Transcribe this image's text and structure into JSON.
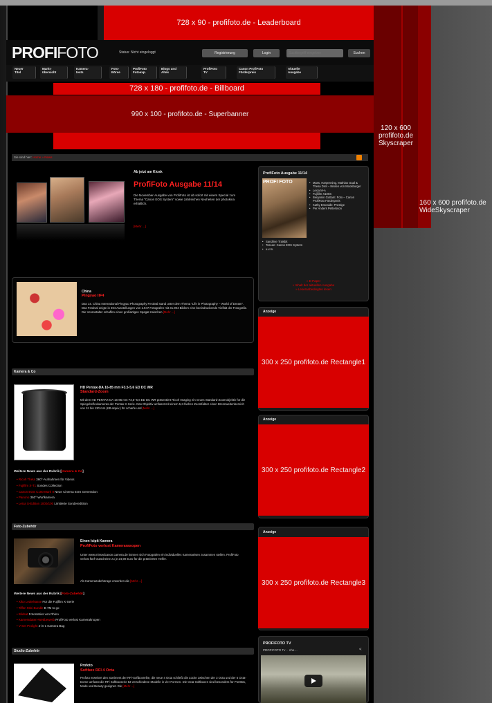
{
  "ads": {
    "leaderboard": "728 x 90 - profifoto.de - Leaderboard",
    "billboard": "728 x 180 - profifoto.de - Billboard",
    "superbanner": "990 x 100 - profifoto.de - Superbanner",
    "skyscraper": "120 x 600 profifoto.de Skyscraper",
    "wide_skyscraper": "160 x 600 profifoto.de WideSkyscraper",
    "rect1": "300 x 250 profifoto.de Rectangle1",
    "rect2": "300 x 250 profifoto.de Rectangle2",
    "rect3": "300 x 250 profifoto.de Rectangle3",
    "ad_label": "Anzeige"
  },
  "header": {
    "logo_bold": "PROFI",
    "logo_thin": "FOTO",
    "status": "Status: Nicht eingeloggt",
    "register": "Registrierung",
    "login": "Login",
    "search_placeholder": "Suchbegriff eingeben",
    "search_btn": "Suchen"
  },
  "nav": [
    {
      "label": "Neuer Titel"
    },
    {
      "label": "Markt-übersicht"
    },
    {
      "label": "Kamera-tests"
    },
    {
      "label": "Foto-Börse"
    },
    {
      "label": "ProfiFoto Fotoexp."
    },
    {
      "label": "Blogs und Altes"
    },
    {
      "label": "ProfiFoto TV"
    },
    {
      "label": "Canon ProfiFoto Förderpreis"
    },
    {
      "label": "Aktuelle Ausgabe"
    }
  ],
  "breadcrumb": {
    "prefix": "Sie sind hier:",
    "path": "Home » News"
  },
  "issue": {
    "kicker": "Ab jetzt am Kiosk",
    "title": "ProfiFoto Ausgabe 11/14",
    "text": "Die November-Ausgabe von ProfiFoto ist ab sofort mit einem Special zum Thema \"Canon EOS System\" sowie zahlreichen Neuheiten der photokina erhältlich.",
    "more": "[Mehr ...]"
  },
  "china": {
    "kicker": "China",
    "title": "Pingyao IIF4",
    "text": "Das 14. China International Pingyao Photography Festival stand unter dem Thema \"Life in Photography – World of Dream\". Das Festival zeigte in 494 Ausstellungen von 1.947 Fotografen mit 31.904 Bildern eine beeindruckende Vielfalt der Fotografie. Die Veranstalter schaffen einen großartigen Spagat zwischen",
    "more": "[Mehr ...]"
  },
  "sections": {
    "kamera": "Kamera & Co",
    "foto": "Foto-Zubehör",
    "studio": "Studio-Zubehör"
  },
  "lens": {
    "kicker": "HD Pentax-DA 16-85 mm F3.5-5.6 ED DC WR",
    "title": "Standard-Zoom",
    "text": "Mit dem HD PENTAX-DA 16-85 mm F3,5–5,6 ED DC WR präsentiert Ricoh Imaging ein neues Standard-Zoomobjektiv für die Spiegelreflexkameras der Pentax K-Serie. Das Objektiv umfasst mit einem 5,3-fachen Zoomfaktor einen Brennweitenbereich von 24 bis 130 mm (KB-äquiv.) für scharfe und",
    "more": "[Mehr ...]"
  },
  "more_kamera": {
    "head": "Weitere News aus der Rubrik",
    "rubric": "Kamera & Co",
    "items": [
      {
        "link": "Ricoh Theta",
        "text": " 360°-Aufnahmen für Videos"
      },
      {
        "link": "Fujifilm X-T1",
        "text": " Sondes Collection"
      },
      {
        "link": "Canon EOS C100 Mark II",
        "text": " Neue Cinema EOS Generation"
      },
      {
        "link": "Panono",
        "text": " 360°-Wurfkamera"
      },
      {
        "link": "Leica S-Edition 1000/100",
        "text": " Limitierte Sondereditiion"
      }
    ]
  },
  "cam": {
    "kicker": "Einen Icipit Kamera",
    "title": "ProfiFoto verlost Kamerarasopen",
    "text": "Unter www.missedcanon.camera.de können sich Fotografen ein individuelles Kameraeisen zusammen stellen. ProfiFoto verlost fünf Gutscheine zu je 24,90 Euro für die prämierten Helfer.",
    "text2": "Als Kamerazubehörage erwerben die",
    "more": "[Mehr ...]"
  },
  "more_foto": {
    "head": "Weitere News aus der Rubrik",
    "rubric": "Foto-Zubehör",
    "items": [
      {
        "link": "Xiko Lederkasse",
        "text": " Für die Fujifilm X-Serie"
      },
      {
        "link": "Tiffen Mini Bundle",
        "text": " B 7M to go"
      },
      {
        "link": "Bildsat",
        "text": " Fotostativs von Rhino"
      },
      {
        "link": "Kamersdaten-Wettbewerb",
        "text": " ProfiFoto verlost Kameraknopen"
      },
      {
        "link": "V-Set Prolight",
        "text": " 4-in-1 Kamera Bag"
      }
    ]
  },
  "soft": {
    "kicker": "Profoto",
    "title": "Softbox RFI 4 Octa",
    "text": "Profoto erweitert den Sortiment der RFi-Softboxreihe, die neue 4 Octa schließt die Lücke zwischen der 3 Octa und der 5 Octa-Dome umfasst die RFi Softboxserie 53 verschiedene Modelle in vier Formen. Die Octa-Softboxen sind besonders für Porträts, Mode und Beauty geeignet. Die",
    "more": "[Mehr ...]"
  },
  "issue_side": {
    "head": "ProfiFoto Ausgabe 11/14",
    "logo": "PROFI FOTO",
    "items": [
      "Mass, Harpenning, Mathias Gaal & Thesa Dret – Nissen von Moosburger",
      "Leica M-A",
      "Fujifilm X100S",
      "Benjamin Guttam: Foto – Canon ProfiFoto Förderpreis",
      "Kathy Emealde: Prestige",
      "Per Anders Pettersson"
    ],
    "items2": [
      "Sandrine Traisbit",
      "Toscan: Canon EOS System",
      "u.v.m."
    ],
    "links": [
      "» E-Paper",
      "» Inhalt der aktuellen Ausgabe",
      "» Leseranbedingten lesen"
    ]
  },
  "tv": {
    "head": "PROFIFOTO TV",
    "sub": "PROFIFOTO Tv ·· nhe…",
    "share": "<"
  }
}
